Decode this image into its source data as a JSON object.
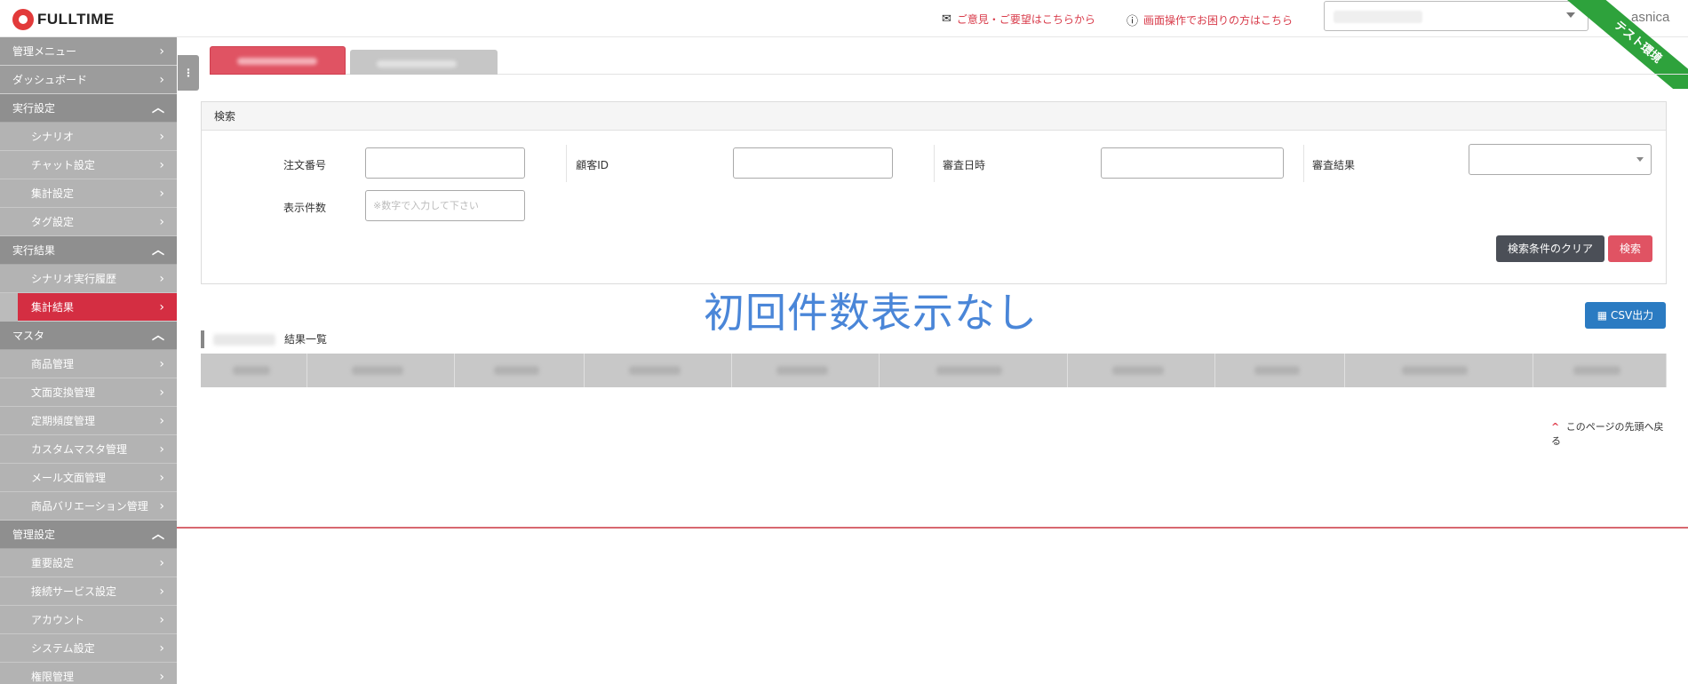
{
  "header": {
    "logo_text": "FULLTIME",
    "feedback_link": "ご意見・ご要望はこちらから",
    "help_link": "画面操作でお困りの方はこちら",
    "user": "asnica",
    "ribbon": "テスト環境"
  },
  "sidebar": {
    "items": [
      {
        "label": "管理メニュー",
        "type": "top"
      },
      {
        "label": "ダッシュボード",
        "type": "top"
      },
      {
        "label": "実行設定",
        "type": "section"
      },
      {
        "label": "シナリオ",
        "type": "sub"
      },
      {
        "label": "チャット設定",
        "type": "sub"
      },
      {
        "label": "集計設定",
        "type": "sub"
      },
      {
        "label": "タグ設定",
        "type": "sub"
      },
      {
        "label": "実行結果",
        "type": "section"
      },
      {
        "label": "シナリオ実行履歴",
        "type": "sub"
      },
      {
        "label": "集計結果",
        "type": "active"
      },
      {
        "label": "マスタ",
        "type": "section"
      },
      {
        "label": "商品管理",
        "type": "sub"
      },
      {
        "label": "文面変換管理",
        "type": "sub"
      },
      {
        "label": "定期頻度管理",
        "type": "sub"
      },
      {
        "label": "カスタムマスタ管理",
        "type": "sub"
      },
      {
        "label": "メール文面管理",
        "type": "sub"
      },
      {
        "label": "商品バリエーション管理",
        "type": "sub"
      },
      {
        "label": "管理設定",
        "type": "section"
      },
      {
        "label": "重要設定",
        "type": "sub"
      },
      {
        "label": "接続サービス設定",
        "type": "sub"
      },
      {
        "label": "アカウント",
        "type": "sub"
      },
      {
        "label": "システム設定",
        "type": "sub"
      },
      {
        "label": "権限管理",
        "type": "sub"
      }
    ]
  },
  "search": {
    "title": "検索",
    "order_no_label": "注文番号",
    "customer_id_label": "顧客ID",
    "review_date_label": "審査日時",
    "review_result_label": "審査結果",
    "display_count_label": "表示件数",
    "display_count_placeholder": "※数字で入力して下さい",
    "clear_button": "検索条件のクリア",
    "search_button": "検索"
  },
  "main": {
    "overlay_note": "初回件数表示なし",
    "csv_button": "CSV出力",
    "list_title": "結果一覧",
    "back_to_top": "このページの先頭へ戻る"
  },
  "colors": {
    "accent": "#e05363",
    "active_sidebar": "#d42e42",
    "link": "#d83b4a",
    "csv_blue": "#2b7bc2",
    "ribbon_green": "#2ea23c",
    "overlay_blue": "#4a86d8"
  }
}
